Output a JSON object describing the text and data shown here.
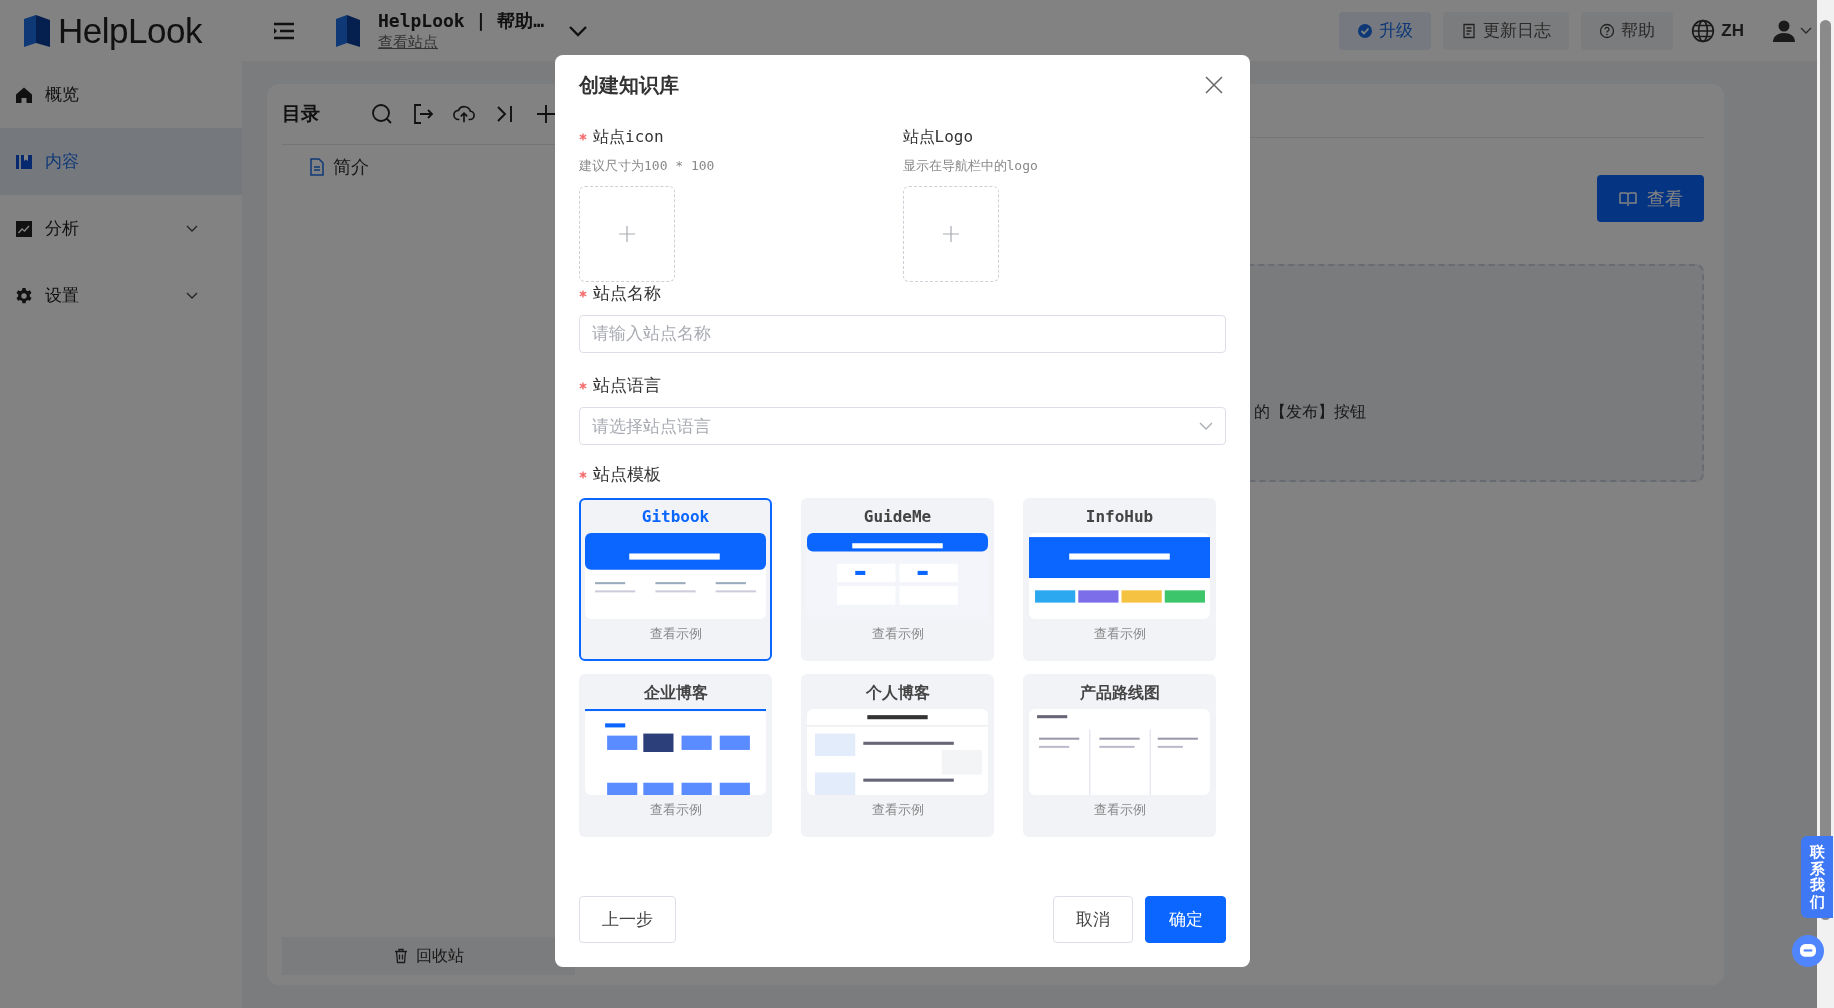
{
  "header": {
    "brand": "HelpLook",
    "site_title": "HelpLook | 帮助…",
    "site_link": "查看站点",
    "actions": [
      {
        "label": "升级",
        "kind": "upgrade"
      },
      {
        "label": "更新日志",
        "kind": "changelog"
      },
      {
        "label": "帮助",
        "kind": "help"
      },
      {
        "label": "ZH",
        "kind": "language"
      }
    ]
  },
  "sidebar": {
    "items": [
      {
        "label": "概览",
        "kind": "home",
        "selected": false,
        "expandable": false
      },
      {
        "label": "内容",
        "kind": "content",
        "selected": true,
        "expandable": false
      },
      {
        "label": "分析",
        "kind": "analytics",
        "selected": false,
        "expandable": true
      },
      {
        "label": "设置",
        "kind": "settings",
        "selected": false,
        "expandable": true
      }
    ]
  },
  "directory": {
    "title": "目录",
    "items": [
      {
        "label": "简介"
      }
    ],
    "recycle_bin": "回收站"
  },
  "content": {
    "view_button": "查看",
    "notice": "的【发布】按钮"
  },
  "dialog": {
    "title": "创建知识库",
    "fields": [
      {
        "kind": "upload",
        "label": "站点icon",
        "required": true,
        "hint": "建议尺寸为100 * 100"
      },
      {
        "kind": "upload",
        "label": "站点Logo",
        "required": false,
        "hint": "显示在导航栏中的logo"
      },
      {
        "kind": "text",
        "label": "站点名称",
        "required": true,
        "placeholder": "请输入站点名称"
      },
      {
        "kind": "select",
        "label": "站点语言",
        "required": true,
        "placeholder": "请选择站点语言"
      }
    ],
    "template_label": "站点模板",
    "template_required": true,
    "templates": [
      {
        "name": "Gitbook",
        "selected": true,
        "kind": "hero",
        "link": "查看示例"
      },
      {
        "name": "GuideMe",
        "selected": false,
        "kind": "cards",
        "link": "查看示例"
      },
      {
        "name": "InfoHub",
        "selected": false,
        "kind": "banner",
        "link": "查看示例"
      },
      {
        "name": "企业博客",
        "selected": false,
        "kind": "grid",
        "link": "查看示例"
      },
      {
        "name": "个人博客",
        "selected": false,
        "kind": "blog",
        "link": "查看示例"
      },
      {
        "name": "产品路线图",
        "selected": false,
        "kind": "roadmap",
        "link": "查看示例"
      }
    ],
    "buttons": [
      {
        "label": "上一步",
        "kind": "back"
      },
      {
        "label": "取消",
        "kind": "cancel"
      },
      {
        "label": "确定",
        "kind": "primary"
      }
    ]
  },
  "contact_tab": "联系我们"
}
